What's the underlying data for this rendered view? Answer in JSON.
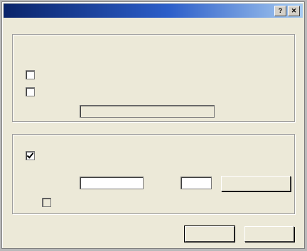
{
  "dialog": {
    "title": ""
  },
  "titlebar": {
    "help_glyph": "?",
    "close_glyph": "✕"
  },
  "auto_group": {
    "legend": "",
    "description": "",
    "detect_label": "",
    "script_label": "",
    "script_checked": false,
    "address_label": "",
    "address_value": "",
    "controls_disabled": true
  },
  "proxy_group": {
    "legend": "",
    "use_proxy_label": "",
    "use_proxy_checked": true,
    "address_label": "",
    "address_value": "",
    "port_label": "",
    "port_value": "",
    "advanced_label": "",
    "bypass_label": "",
    "bypass_checked": false,
    "bypass_disabled": true
  },
  "footer": {
    "ok_label": "",
    "cancel_label": ""
  },
  "colors": {
    "titlebar": "#0a246a",
    "titlebar_end": "#a6caf0",
    "face": "#ece9d8",
    "desktop": "#b9b9ba"
  }
}
